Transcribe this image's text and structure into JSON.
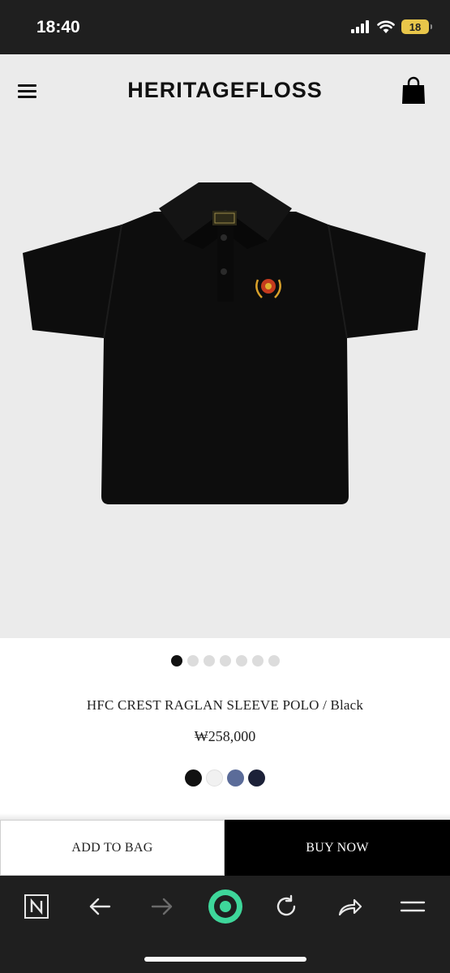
{
  "status_bar": {
    "time": "18:40",
    "battery": "18",
    "icons": [
      "cellular-signal-icon",
      "wifi-icon",
      "battery-icon"
    ]
  },
  "header": {
    "brand": "HERITAGEFLOSS",
    "menu_icon": "hamburger-menu-icon",
    "bag_icon": "shopping-bag-icon"
  },
  "gallery": {
    "image_count": 7,
    "active_index": 0,
    "image_description_icon": "black-polo-shirt-image"
  },
  "product": {
    "title": "HFC CREST RAGLAN SLEEVE POLO / Black",
    "price": "₩258,000"
  },
  "swatches": [
    {
      "name": "black",
      "color": "#111111"
    },
    {
      "name": "white",
      "color": "#f1f1f1"
    },
    {
      "name": "blue",
      "color": "#5b6c99"
    },
    {
      "name": "navy",
      "color": "#1c2138"
    }
  ],
  "actions": {
    "add_to_bag": "ADD TO BAG",
    "buy_now": "BUY NOW"
  },
  "browser_bar": {
    "icons": [
      "naver-icon",
      "back-arrow-icon",
      "forward-arrow-icon",
      "home-circle-icon",
      "reload-icon",
      "share-icon",
      "menu-icon"
    ],
    "accent_color": "#3ed69a"
  }
}
